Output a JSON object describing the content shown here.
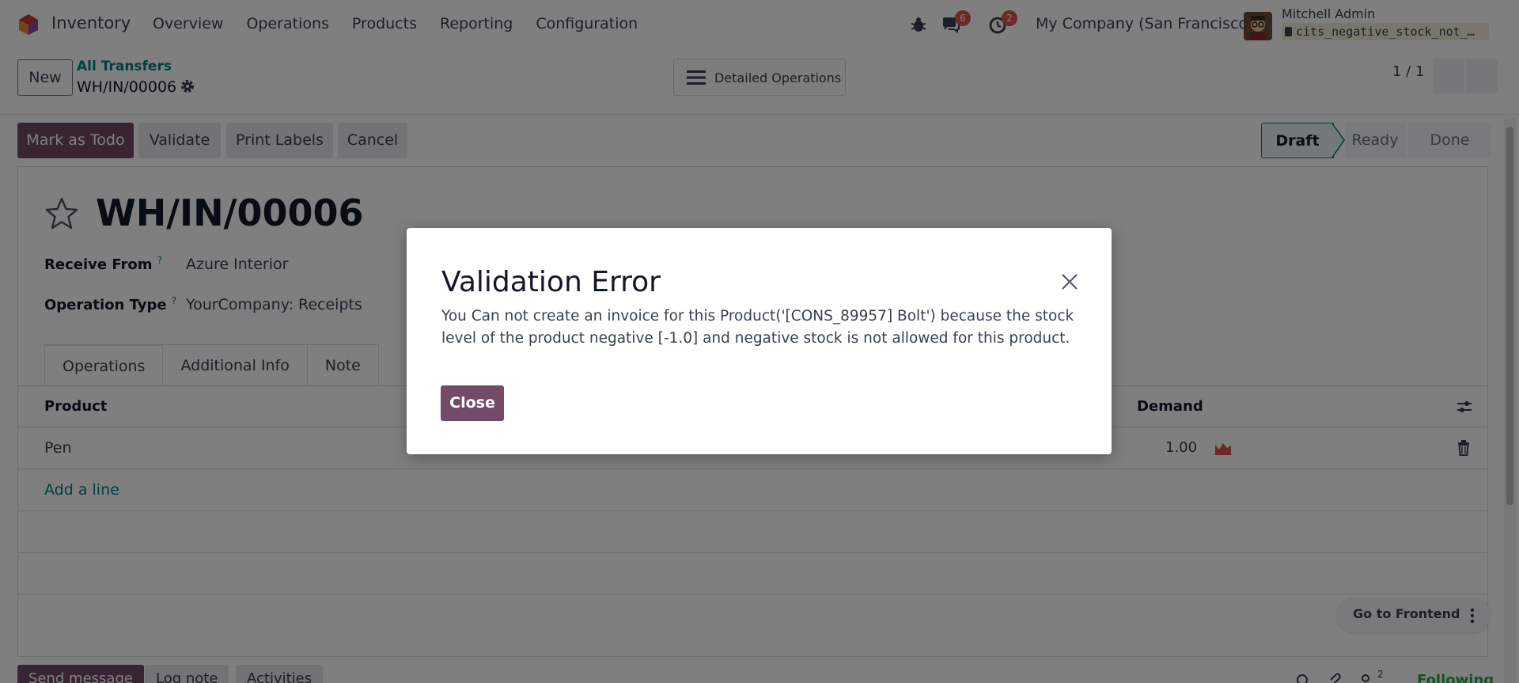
{
  "app": {
    "name": "Inventory",
    "menu": [
      "Overview",
      "Operations",
      "Products",
      "Reporting",
      "Configuration"
    ],
    "discuss_count": "6",
    "activity_count": "2",
    "company": "My Company (San Francisco)",
    "user_name": "Mitchell Admin",
    "db_name": "cits_negative_stock_not_…"
  },
  "control": {
    "new_label": "New",
    "breadcrumb_parent": "All Transfers",
    "breadcrumb_current": "WH/IN/00006",
    "detailed_label": "Detailed Operations",
    "pager": "1 / 1"
  },
  "statusbar": {
    "buttons": [
      "Mark as Todo",
      "Validate",
      "Print Labels",
      "Cancel"
    ],
    "stages": [
      "Draft",
      "Ready",
      "Done"
    ],
    "active_stage": "Draft"
  },
  "form": {
    "title": "WH/IN/00006",
    "receive_from_label": "Receive From",
    "receive_from_value": "Azure Interior",
    "operation_type_label": "Operation Type",
    "operation_type_value": "YourCompany: Receipts",
    "help_mark": "?",
    "tabs": [
      "Operations",
      "Additional Info",
      "Note"
    ],
    "columns": {
      "product": "Product",
      "demand": "Demand"
    },
    "rows": [
      {
        "product": "Pen",
        "demand": "1.00"
      }
    ],
    "add_line": "Add a line"
  },
  "floating": {
    "go_to_frontend": "Go to Frontend"
  },
  "chatter": {
    "send_message": "Send message",
    "log_note": "Log note",
    "activities": "Activities",
    "followers_count": "2",
    "following": "Following"
  },
  "modal": {
    "title": "Validation Error",
    "message": "You Can not create an invoice for this Product('[CONS_89957] Bolt') because the stock level of the product negative [-1.0] and negative stock is not allowed for this product.",
    "close_button": "Close"
  },
  "colors": {
    "brand": "#714b67",
    "link": "#017e84",
    "badge": "#d9534f"
  }
}
